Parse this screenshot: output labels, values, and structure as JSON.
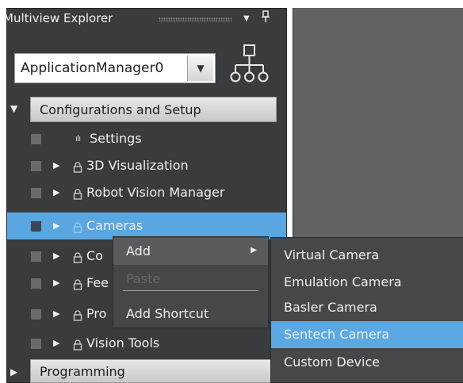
{
  "panel": {
    "title": "Multiview Explorer",
    "dropdown_icon": "triangle-down-icon",
    "pin_icon": "pin-icon"
  },
  "app_selector": {
    "value": "ApplicationManager0",
    "hierarchy_icon": "hierarchy-icon"
  },
  "sections": [
    {
      "label": "Configurations and Setup",
      "expanded": true
    },
    {
      "label": "Programming",
      "expanded": false
    }
  ],
  "tree": [
    {
      "label": "Settings",
      "icon": "settings-icon"
    },
    {
      "label": "3D Visualization",
      "icon": "lock-icon"
    },
    {
      "label": "Robot Vision Manager",
      "icon": "lock-icon"
    },
    {
      "label": "Cameras",
      "icon": "lock-icon",
      "selected": true
    },
    {
      "label": "Co",
      "icon": "lock-icon"
    },
    {
      "label": "Fee",
      "icon": "lock-icon"
    },
    {
      "label": "Pro",
      "icon": "lock-icon"
    },
    {
      "label": "Vision Tools",
      "icon": "lock-icon"
    }
  ],
  "context_menu": {
    "items": [
      {
        "label": "Add",
        "has_submenu": true
      },
      {
        "label": "Paste",
        "disabled": true
      },
      {
        "label": "Add Shortcut"
      }
    ]
  },
  "submenu": {
    "items": [
      {
        "label": "Virtual Camera"
      },
      {
        "label": "Emulation Camera"
      },
      {
        "label": "Basler Camera"
      },
      {
        "label": "Sentech Camera",
        "highlighted": true
      },
      {
        "label": "Custom Device"
      }
    ]
  },
  "colors": {
    "panel_bg": "#3a3b3d",
    "selection": "#59a6e0",
    "menu_bg": "#464749"
  }
}
